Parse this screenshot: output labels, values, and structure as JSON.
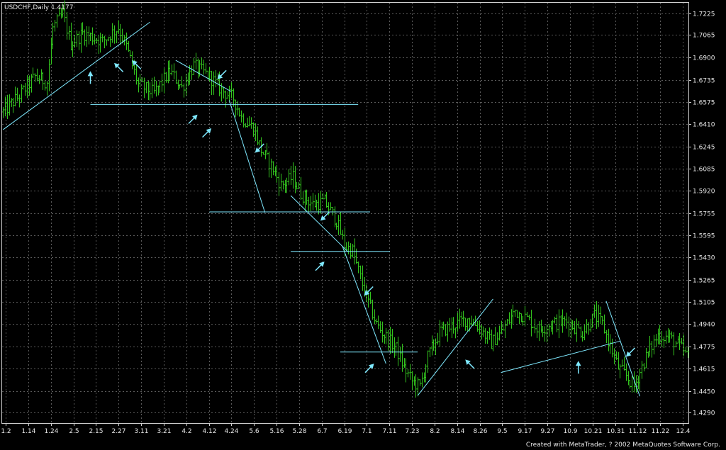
{
  "chart_data": {
    "type": "bar",
    "title": "USDCHF,Daily  1.4177",
    "symbol": "USDCHF",
    "timeframe": "Daily",
    "current_price": 1.4177,
    "ylim": [
      1.4213,
      1.7302
    ],
    "y_ticks": [
      "1.7225",
      "1.7065",
      "1.6900",
      "1.6735",
      "1.6575",
      "1.6410",
      "1.6245",
      "1.6085",
      "1.5920",
      "1.5755",
      "1.5595",
      "1.5430",
      "1.5265",
      "1.5105",
      "1.4940",
      "1.4775",
      "1.4615",
      "1.4450",
      "1.4290"
    ],
    "x_ticks": [
      "1.2",
      "1.14",
      "1.24",
      "2.5",
      "2.15",
      "2.27",
      "3.11",
      "3.21",
      "4.2",
      "4.12",
      "4.24",
      "5.6",
      "5.16",
      "5.28",
      "6.7",
      "6.19",
      "7.1",
      "7.11",
      "7.23",
      "8.2",
      "8.14",
      "8.26",
      "9.5",
      "9.17",
      "9.27",
      "10.9",
      "10.21",
      "10.31",
      "11.12",
      "11.22",
      "12.4"
    ],
    "grid": true,
    "bar_color": "#33c41e",
    "annotation_color": "#7fe9ff",
    "background": "#000000",
    "price_path": [
      [
        0,
        1.65
      ],
      [
        8,
        1.662
      ],
      [
        16,
        1.676
      ],
      [
        22,
        1.672
      ],
      [
        25,
        1.712
      ],
      [
        30,
        1.722
      ],
      [
        34,
        1.7
      ],
      [
        40,
        1.708
      ],
      [
        50,
        1.702
      ],
      [
        58,
        1.712
      ],
      [
        62,
        1.698
      ],
      [
        68,
        1.67
      ],
      [
        76,
        1.664
      ],
      [
        84,
        1.68
      ],
      [
        90,
        1.668
      ],
      [
        96,
        1.684
      ],
      [
        104,
        1.676
      ],
      [
        110,
        1.666
      ],
      [
        116,
        1.66
      ],
      [
        120,
        1.646
      ],
      [
        126,
        1.638
      ],
      [
        130,
        1.622
      ],
      [
        136,
        1.608
      ],
      [
        140,
        1.596
      ],
      [
        146,
        1.602
      ],
      [
        150,
        1.59
      ],
      [
        156,
        1.582
      ],
      [
        162,
        1.584
      ],
      [
        168,
        1.57
      ],
      [
        172,
        1.552
      ],
      [
        176,
        1.548
      ],
      [
        180,
        1.528
      ],
      [
        184,
        1.51
      ],
      [
        188,
        1.494
      ],
      [
        192,
        1.486
      ],
      [
        198,
        1.476
      ],
      [
        202,
        1.462
      ],
      [
        206,
        1.452
      ],
      [
        210,
        1.448
      ],
      [
        214,
        1.47
      ],
      [
        220,
        1.488
      ],
      [
        228,
        1.494
      ],
      [
        234,
        1.498
      ],
      [
        240,
        1.492
      ],
      [
        246,
        1.48
      ],
      [
        252,
        1.49
      ],
      [
        258,
        1.504
      ],
      [
        264,
        1.498
      ],
      [
        270,
        1.49
      ],
      [
        276,
        1.494
      ],
      [
        284,
        1.496
      ],
      [
        292,
        1.488
      ],
      [
        298,
        1.5
      ],
      [
        302,
        1.494
      ],
      [
        306,
        1.478
      ],
      [
        310,
        1.462
      ],
      [
        314,
        1.456
      ],
      [
        318,
        1.448
      ],
      [
        324,
        1.47
      ],
      [
        330,
        1.486
      ],
      [
        336,
        1.484
      ],
      [
        342,
        1.476
      ],
      [
        345,
        1.47
      ]
    ],
    "annotations": {
      "lines": [
        {
          "x1": 0,
          "y1": 1.637,
          "x2": 74,
          "y2": 1.716
        },
        {
          "x1": 87,
          "y1": 1.688,
          "x2": 115,
          "y2": 1.665
        },
        {
          "x1": 44,
          "y1": 1.6555,
          "x2": 179,
          "y2": 1.6555
        },
        {
          "x1": 114,
          "y1": 1.6585,
          "x2": 132,
          "y2": 1.576
        },
        {
          "x1": 104,
          "y1": 1.5765,
          "x2": 185,
          "y2": 1.5765
        },
        {
          "x1": 145,
          "y1": 1.5885,
          "x2": 174,
          "y2": 1.547
        },
        {
          "x1": 145,
          "y1": 1.5475,
          "x2": 195,
          "y2": 1.5475
        },
        {
          "x1": 171,
          "y1": 1.5515,
          "x2": 193,
          "y2": 1.465
        },
        {
          "x1": 170,
          "y1": 1.4735,
          "x2": 209,
          "y2": 1.4735
        },
        {
          "x1": 209,
          "y1": 1.4415,
          "x2": 247,
          "y2": 1.5125
        },
        {
          "x1": 251,
          "y1": 1.4585,
          "x2": 311,
          "y2": 1.4815
        },
        {
          "x1": 304,
          "y1": 1.511,
          "x2": 321,
          "y2": 1.441
        }
      ],
      "arrows": [
        {
          "x": 44,
          "y": 1.68,
          "dir": "up"
        },
        {
          "x": 56,
          "y": 1.686,
          "dir": "up-left"
        },
        {
          "x": 65,
          "y": 1.688,
          "dir": "up-left"
        },
        {
          "x": 108,
          "y": 1.674,
          "dir": "down-left"
        },
        {
          "x": 98,
          "y": 1.648,
          "dir": "up-right"
        },
        {
          "x": 105,
          "y": 1.638,
          "dir": "up-right"
        },
        {
          "x": 127,
          "y": 1.62,
          "dir": "down-left"
        },
        {
          "x": 160,
          "y": 1.57,
          "dir": "down-left"
        },
        {
          "x": 162,
          "y": 1.54,
          "dir": "up-right"
        },
        {
          "x": 182,
          "y": 1.515,
          "dir": "down-left"
        },
        {
          "x": 187,
          "y": 1.465,
          "dir": "up-right"
        },
        {
          "x": 233,
          "y": 1.468,
          "dir": "up-left"
        },
        {
          "x": 290,
          "y": 1.467,
          "dir": "up"
        },
        {
          "x": 314,
          "y": 1.47,
          "dir": "down-left"
        }
      ]
    }
  },
  "footer": "Created with MetaTrader, ? 2002 MetaQuotes Software Corp."
}
